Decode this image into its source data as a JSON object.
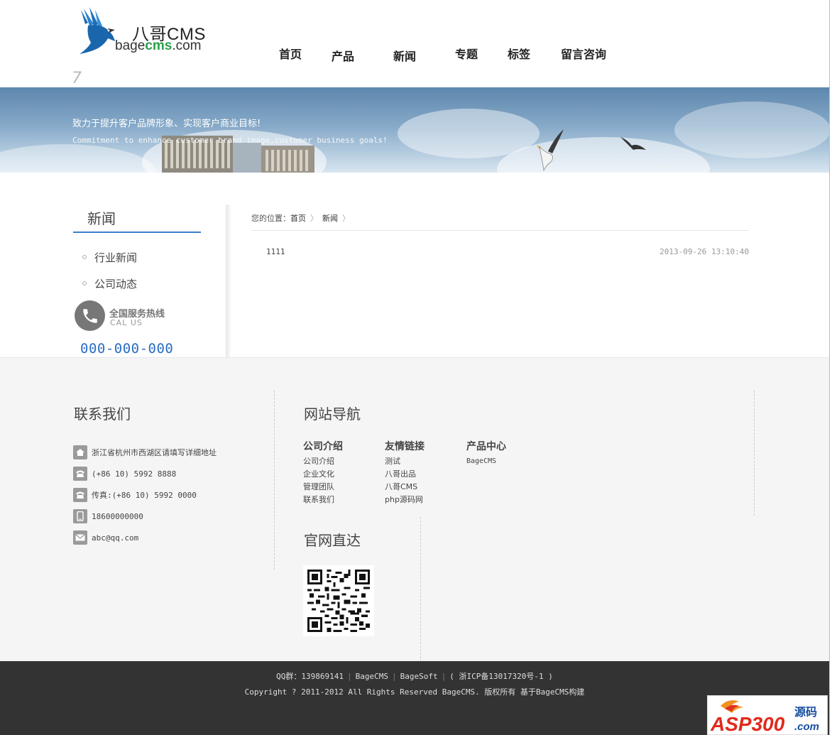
{
  "header": {
    "logo_cn": "八哥CMS",
    "logo_domain_prefix": "bage",
    "logo_domain_highlight": "cms",
    "logo_domain_suffix": ".com",
    "nav": [
      "首页",
      "产品",
      "新闻",
      "专题",
      "标签",
      "留言咨询"
    ]
  },
  "banner": {
    "title": "致力于提升客户品牌形象、实现客户商业目标!",
    "subtitle": "Commitment to enhance customer brand image,customer business goals!"
  },
  "sidebar": {
    "title": "新闻",
    "items": [
      "行业新闻",
      "公司动态"
    ],
    "hotline_cn": "全国服务热线",
    "hotline_en": "CAL US",
    "hotline_number": "000-000-000"
  },
  "breadcrumb": {
    "prefix": "您的位置：",
    "home": "首页",
    "current": "新闻",
    "sep": "〉"
  },
  "articles": [
    {
      "title": "1111",
      "date": "2013-09-26 13:10:40"
    }
  ],
  "footer": {
    "contact_heading": "联系我们",
    "contacts": [
      {
        "icon": "home-icon",
        "text": "浙江省杭州市西湖区请填写详细地址"
      },
      {
        "icon": "phone-icon",
        "text": "(+86 10) 5992 8888"
      },
      {
        "icon": "fax-icon",
        "text": "传真:(+86 10) 5992 0000"
      },
      {
        "icon": "mobile-icon",
        "text": "18600000000"
      },
      {
        "icon": "mail-icon",
        "text": "abc@qq.com"
      }
    ],
    "nav_heading": "网站导航",
    "link_columns": [
      {
        "title": "公司介绍",
        "links": [
          "公司介绍",
          "企业文化",
          "管理团队",
          "联系我们"
        ]
      },
      {
        "title": "友情链接",
        "links": [
          "测试",
          "八哥出品",
          "八哥CMS",
          "php源码网"
        ]
      },
      {
        "title": "产品中心",
        "links": [
          "BageCMS"
        ]
      }
    ],
    "official_heading": "官网直达"
  },
  "bottom": {
    "qq": "QQ群：139869141",
    "link1": "BageCMS",
    "link2": "BageSoft",
    "icp": "( 浙ICP备13017320号-1 )",
    "copyright": "Copyright ? 2011-2012 All Rights Reserved BageCMS. 版权所有 基于BageCMS构建"
  },
  "watermark": {
    "brand": "ASP300",
    "cn": "源码",
    "suffix": ".com"
  },
  "colors": {
    "accent": "#3a7fcf",
    "hotline": "#2a6cc4",
    "bottom_bg": "#333333",
    "logo_green": "#2aa04a"
  }
}
